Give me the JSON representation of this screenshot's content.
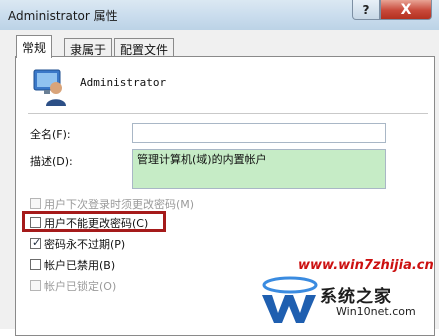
{
  "window": {
    "title": "Administrator 属性",
    "help_symbol": "?",
    "close_symbol": "X"
  },
  "tabs": [
    {
      "label": "常规",
      "active": true
    },
    {
      "label": "隶属于",
      "active": false
    },
    {
      "label": "配置文件",
      "active": false
    }
  ],
  "user": {
    "name": "Administrator",
    "icon": "user-icon"
  },
  "fields": {
    "full_name_label": "全名(F):",
    "full_name_value": "",
    "description_label": "描述(D):",
    "description_value": "管理计算机(域)的内置帐户"
  },
  "options": [
    {
      "label": "用户下次登录时须更改密码(M)",
      "checked": false,
      "disabled": true
    },
    {
      "label": "用户不能更改密码(C)",
      "checked": false,
      "disabled": false,
      "highlighted": true
    },
    {
      "label": "密码永不过期(P)",
      "checked": true,
      "disabled": false
    },
    {
      "label": "帐户已禁用(B)",
      "checked": false,
      "disabled": false
    },
    {
      "label": "帐户已锁定(O)",
      "checked": false,
      "disabled": true
    }
  ],
  "watermark": {
    "url": "www.win7zhijia.cn",
    "brand": "系统之家",
    "site": "Win10net.com"
  },
  "colors": {
    "highlight_border": "#a51a1a",
    "description_bg": "#c6ecc6",
    "close_button": "#c8493a"
  }
}
